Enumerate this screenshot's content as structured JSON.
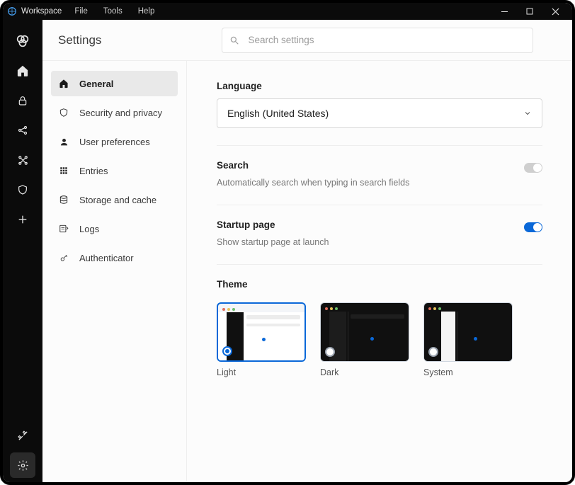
{
  "menubar": {
    "app": "Workspace",
    "items": [
      "File",
      "Tools",
      "Help"
    ]
  },
  "rail": [
    {
      "name": "logo-icon"
    },
    {
      "name": "home-icon"
    },
    {
      "name": "lock-icon"
    },
    {
      "name": "share-alt-icon"
    },
    {
      "name": "graph-icon"
    },
    {
      "name": "shield-icon"
    },
    {
      "name": "plus-icon"
    }
  ],
  "rail_footer": [
    {
      "name": "tools-crossed-icon"
    },
    {
      "name": "gear-icon",
      "active": true
    }
  ],
  "page_title": "Settings",
  "search": {
    "placeholder": "Search settings"
  },
  "sidebar": {
    "items": [
      {
        "label": "General",
        "icon": "home-icon",
        "active": true
      },
      {
        "label": "Security and privacy",
        "icon": "shield-icon"
      },
      {
        "label": "User preferences",
        "icon": "user-icon"
      },
      {
        "label": "Entries",
        "icon": "grid-icon"
      },
      {
        "label": "Storage and cache",
        "icon": "database-icon"
      },
      {
        "label": "Logs",
        "icon": "logs-icon"
      },
      {
        "label": "Authenticator",
        "icon": "key-icon"
      }
    ]
  },
  "sections": {
    "language": {
      "title": "Language",
      "value": "English (United States)"
    },
    "search_typing": {
      "title": "Search",
      "subtitle": "Automatically search when typing in search fields",
      "on": false
    },
    "startup": {
      "title": "Startup page",
      "subtitle": "Show startup page at launch",
      "on": true
    },
    "theme": {
      "title": "Theme",
      "options": [
        {
          "label": "Light",
          "selected": true,
          "variant": "light"
        },
        {
          "label": "Dark",
          "selected": false,
          "variant": "dark"
        },
        {
          "label": "System",
          "selected": false,
          "variant": "system"
        }
      ]
    }
  }
}
